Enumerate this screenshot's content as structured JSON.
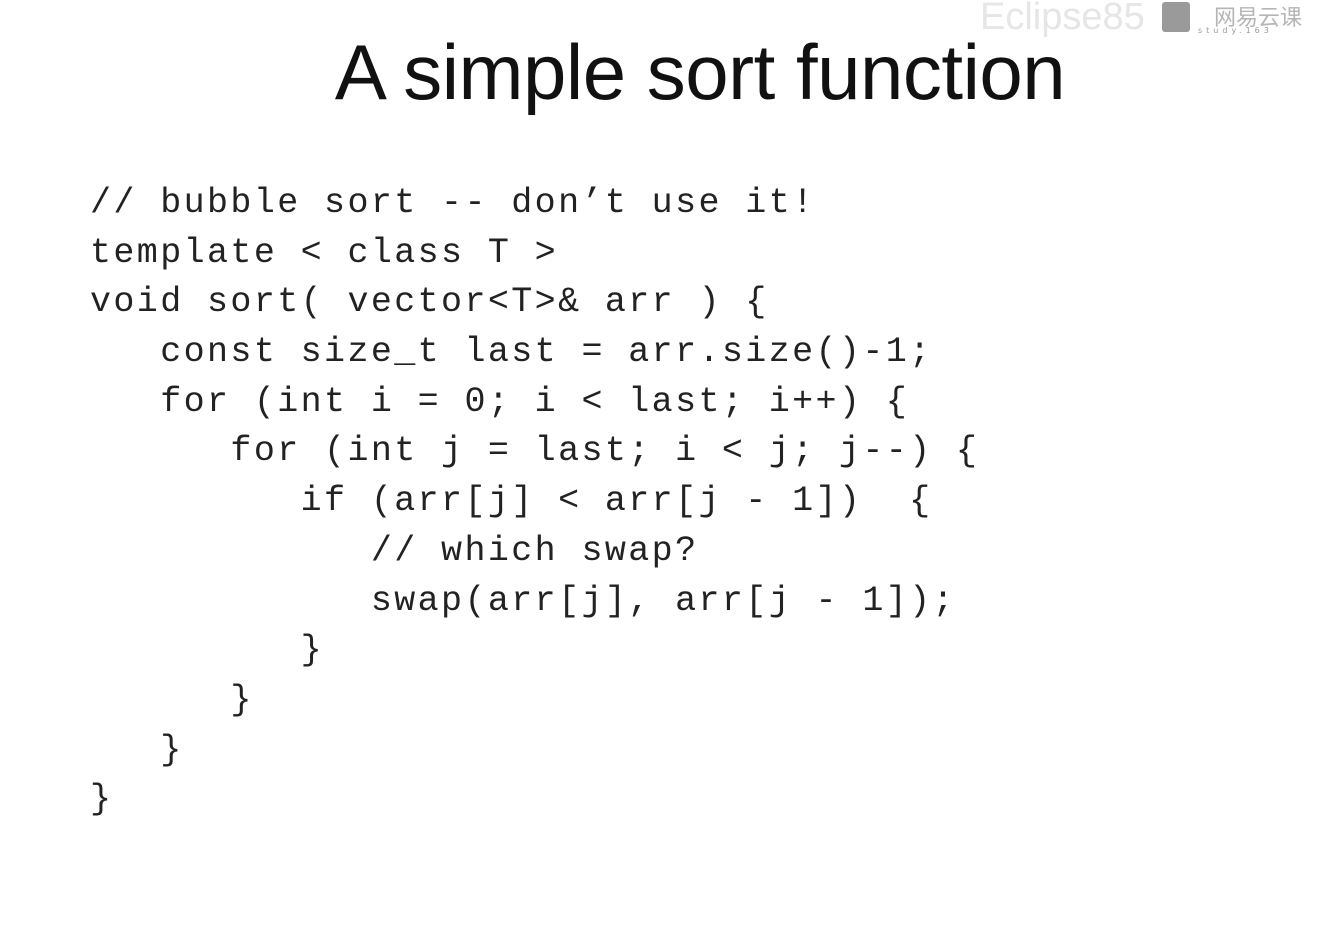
{
  "slide": {
    "title": "A simple sort function",
    "code_lines": [
      "// bubble sort -- don’t use it!",
      "template < class T >",
      "void sort( vector<T>& arr ) {",
      "   const size_t last = arr.size()-1;",
      "   for (int i = 0; i < last; i++) {",
      "      for (int j = last; i < j; j--) {",
      "         if (arr[j] < arr[j - 1])  {",
      "            // which swap?",
      "            swap(arr[j], arr[j - 1]);",
      "         }",
      "      }",
      "   }",
      "}"
    ]
  },
  "watermark": {
    "text": "Eclipse85",
    "cn": "网易云课",
    "sub": "study.163"
  }
}
